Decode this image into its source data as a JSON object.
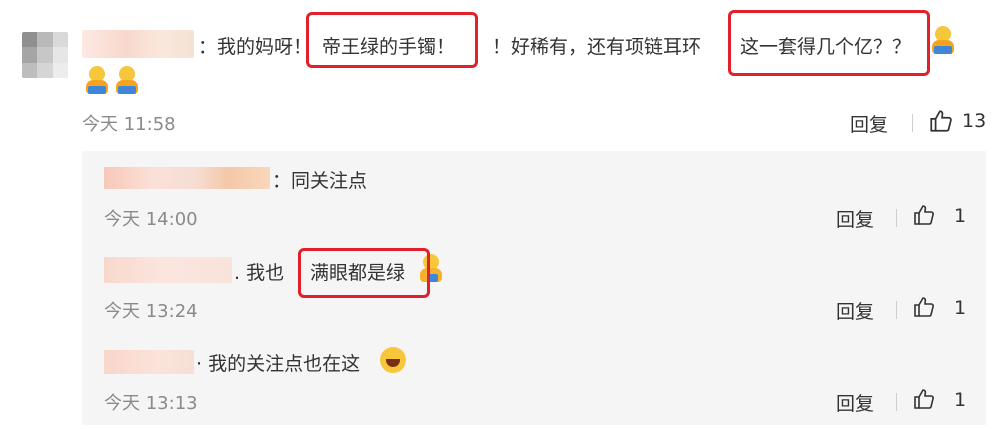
{
  "comment": {
    "text_a": "：我的妈呀！",
    "hl_a": "帝王绿的手镯！",
    "text_b": "！好稀有，还有项链耳环",
    "hl_b": "这一套得几个亿？？",
    "time": "今天 11:58",
    "reply": "回复",
    "likes": "13"
  },
  "replies": [
    {
      "text": "：同关注点",
      "time": "今天 14:00",
      "reply": "回复",
      "likes": "1"
    },
    {
      "text": ". 我也",
      "highlight": "满眼都是绿",
      "time": "今天 13:24",
      "reply": "回复",
      "likes": "1"
    },
    {
      "text": "· 我的关注点也在这",
      "time": "今天 13:13",
      "reply": "回复",
      "likes": "1"
    }
  ],
  "colors": {
    "highlight_border": "#e0202a",
    "reply_bg": "#f5f5f5",
    "time": "#8a8a8a"
  }
}
